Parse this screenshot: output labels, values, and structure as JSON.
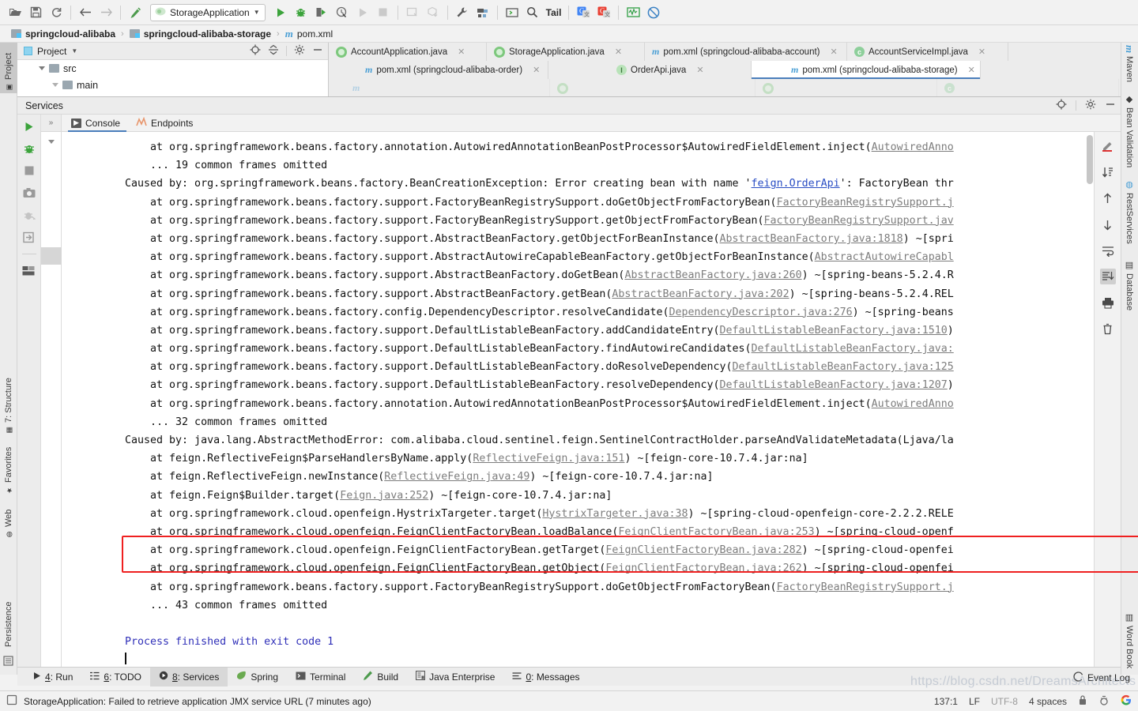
{
  "toolbar": {
    "run_config": "StorageApplication",
    "tail_label": "Tail",
    "buttons": [
      {
        "name": "open-project",
        "icon": "folder-open-icon"
      },
      {
        "name": "save-all",
        "icon": "save-icon"
      },
      {
        "name": "sync",
        "icon": "refresh-icon"
      },
      {
        "name": "back",
        "icon": "arrow-left-icon"
      },
      {
        "name": "forward",
        "icon": "arrow-right-icon"
      },
      {
        "name": "build",
        "icon": "hammer-icon"
      }
    ]
  },
  "breadcrumb": {
    "items": [
      {
        "label": "springcloud-alibaba",
        "icon": "module-folder-icon",
        "bold": true
      },
      {
        "label": "springcloud-alibaba-storage",
        "icon": "module-folder-icon",
        "bold": true
      },
      {
        "label": "pom.xml",
        "icon": "maven-icon",
        "bold": false
      }
    ],
    "separator": "›"
  },
  "left_strip": {
    "items": [
      {
        "label": "Project",
        "icon": "project-icon",
        "active": true
      },
      {
        "label": "7: Structure",
        "icon": "structure-icon",
        "active": false
      },
      {
        "label": "Favorites",
        "icon": "star-icon",
        "active": false
      },
      {
        "label": "Web",
        "icon": "web-icon",
        "active": false
      },
      {
        "label": "Persistence",
        "icon": "persistence-icon",
        "active": false
      }
    ]
  },
  "right_strip": {
    "items": [
      {
        "label": "Maven",
        "icon": "maven-icon"
      },
      {
        "label": "Bean Validation",
        "icon": "bean-validation-icon"
      },
      {
        "label": "RestServices",
        "icon": "rest-services-icon"
      },
      {
        "label": "Database",
        "icon": "database-icon"
      },
      {
        "label": "Word Book",
        "icon": "word-book-icon"
      }
    ]
  },
  "project_panel": {
    "title": "Project",
    "tree": [
      {
        "label": "src",
        "depth": 1
      },
      {
        "label": "main",
        "depth": 2
      }
    ]
  },
  "editor_tabs": {
    "row1": [
      {
        "label": "AccountApplication.java",
        "icon": "spring-class-icon",
        "selected": false
      },
      {
        "label": "StorageApplication.java",
        "icon": "spring-class-icon",
        "selected": false
      },
      {
        "label": "pom.xml (springcloud-alibaba-account)",
        "icon": "maven-icon",
        "selected": false
      },
      {
        "label": "AccountServiceImpl.java",
        "icon": "class-icon",
        "selected": false
      }
    ],
    "row2": [
      {
        "label": "pom.xml (springcloud-alibaba-order)",
        "icon": "maven-icon",
        "selected": false
      },
      {
        "label": "OrderApi.java",
        "icon": "interface-icon",
        "selected": false
      },
      {
        "label": "pom.xml (springcloud-alibaba-storage)",
        "icon": "maven-icon",
        "selected": true
      }
    ],
    "close_glyph": "✕"
  },
  "services": {
    "title": "Services",
    "tabs": [
      {
        "label": "Console",
        "icon": "console-icon",
        "active": true
      },
      {
        "label": "Endpoints",
        "icon": "endpoints-icon",
        "active": false
      }
    ],
    "gutter_icons": [
      {
        "name": "rerun-icon"
      },
      {
        "name": "debug-icon"
      },
      {
        "name": "stop-icon"
      },
      {
        "name": "camera-icon"
      },
      {
        "name": "suspend-icon"
      },
      {
        "name": "export-icon"
      },
      {
        "name": "layout-icon"
      }
    ],
    "right_toolbar_icons": [
      {
        "name": "soft-wrap-icon"
      },
      {
        "name": "scroll-to-end-icon"
      },
      {
        "name": "up-arrow-icon"
      },
      {
        "name": "down-arrow-icon"
      },
      {
        "name": "wrap-text-icon"
      },
      {
        "name": "scroll-to-bottom-icon",
        "active": true
      },
      {
        "name": "print-icon"
      },
      {
        "name": "trash-icon"
      }
    ]
  },
  "console_lines": [
    {
      "id": "l1",
      "text": "    at org.springframework.beans.factory.annotation.AutowiredAnnotationBeanPostProcessor$AutowiredFieldElement.inject(",
      "link": "AutowiredAnno",
      "tail": ""
    },
    {
      "id": "l2",
      "text": "    ... 19 common frames omitted",
      "link": "",
      "tail": ""
    },
    {
      "id": "l3",
      "text": "Caused by: org.springframework.beans.factory.BeanCreationException: Error creating bean with name '",
      "link": "feign.OrderApi",
      "tail": "': FactoryBean thr",
      "link_style": "blue"
    },
    {
      "id": "l4",
      "text": "    at org.springframework.beans.factory.support.FactoryBeanRegistrySupport.doGetObjectFromFactoryBean(",
      "link": "FactoryBeanRegistrySupport.j",
      "tail": ""
    },
    {
      "id": "l5",
      "text": "    at org.springframework.beans.factory.support.FactoryBeanRegistrySupport.getObjectFromFactoryBean(",
      "link": "FactoryBeanRegistrySupport.jav",
      "tail": ""
    },
    {
      "id": "l6",
      "text": "    at org.springframework.beans.factory.support.AbstractBeanFactory.getObjectForBeanInstance(",
      "link": "AbstractBeanFactory.java:1818",
      "tail": ") ~[spri"
    },
    {
      "id": "l7",
      "text": "    at org.springframework.beans.factory.support.AbstractAutowireCapableBeanFactory.getObjectForBeanInstance(",
      "link": "AbstractAutowireCapabl",
      "tail": ""
    },
    {
      "id": "l8",
      "text": "    at org.springframework.beans.factory.support.AbstractBeanFactory.doGetBean(",
      "link": "AbstractBeanFactory.java:260",
      "tail": ") ~[spring-beans-5.2.4.R"
    },
    {
      "id": "l9",
      "text": "    at org.springframework.beans.factory.support.AbstractBeanFactory.getBean(",
      "link": "AbstractBeanFactory.java:202",
      "tail": ") ~[spring-beans-5.2.4.REL"
    },
    {
      "id": "l10",
      "text": "    at org.springframework.beans.factory.config.DependencyDescriptor.resolveCandidate(",
      "link": "DependencyDescriptor.java:276",
      "tail": ") ~[spring-beans"
    },
    {
      "id": "l11",
      "text": "    at org.springframework.beans.factory.support.DefaultListableBeanFactory.addCandidateEntry(",
      "link": "DefaultListableBeanFactory.java:1510",
      "tail": ")"
    },
    {
      "id": "l12",
      "text": "    at org.springframework.beans.factory.support.DefaultListableBeanFactory.findAutowireCandidates(",
      "link": "DefaultListableBeanFactory.java:",
      "tail": ""
    },
    {
      "id": "l13",
      "text": "    at org.springframework.beans.factory.support.DefaultListableBeanFactory.doResolveDependency(",
      "link": "DefaultListableBeanFactory.java:125",
      "tail": ""
    },
    {
      "id": "l14",
      "text": "    at org.springframework.beans.factory.support.DefaultListableBeanFactory.resolveDependency(",
      "link": "DefaultListableBeanFactory.java:1207",
      "tail": ")"
    },
    {
      "id": "l15",
      "text": "    at org.springframework.beans.factory.annotation.AutowiredAnnotationBeanPostProcessor$AutowiredFieldElement.inject(",
      "link": "AutowiredAnno",
      "tail": ""
    },
    {
      "id": "l16",
      "text": "    ... 32 common frames omitted",
      "link": "",
      "tail": ""
    },
    {
      "id": "l17",
      "text": "Caused by: java.lang.AbstractMethodError: com.alibaba.cloud.sentinel.feign.SentinelContractHolder.parseAndValidateMetadata(Ljava/la",
      "link": "",
      "tail": ""
    },
    {
      "id": "l18",
      "text": "    at feign.ReflectiveFeign$ParseHandlersByName.apply(",
      "link": "ReflectiveFeign.java:151",
      "tail": ") ~[feign-core-10.7.4.jar:na]"
    },
    {
      "id": "l19",
      "text": "    at feign.ReflectiveFeign.newInstance(",
      "link": "ReflectiveFeign.java:49",
      "tail": ") ~[feign-core-10.7.4.jar:na]"
    },
    {
      "id": "l20",
      "text": "    at feign.Feign$Builder.target(",
      "link": "Feign.java:252",
      "tail": ") ~[feign-core-10.7.4.jar:na]"
    },
    {
      "id": "l21",
      "text": "    at org.springframework.cloud.openfeign.HystrixTargeter.target(",
      "link": "HystrixTargeter.java:38",
      "tail": ") ~[spring-cloud-openfeign-core-2.2.2.RELE"
    },
    {
      "id": "l22",
      "text": "    at org.springframework.cloud.openfeign.FeignClientFactoryBean.loadBalance(",
      "link": "FeignClientFactoryBean.java:253",
      "tail": ") ~[spring-cloud-openf"
    },
    {
      "id": "l23",
      "text": "    at org.springframework.cloud.openfeign.FeignClientFactoryBean.getTarget(",
      "link": "FeignClientFactoryBean.java:282",
      "tail": ") ~[spring-cloud-openfei"
    },
    {
      "id": "l24",
      "text": "    at org.springframework.cloud.openfeign.FeignClientFactoryBean.getObject(",
      "link": "FeignClientFactoryBean.java:262",
      "tail": ") ~[spring-cloud-openfei"
    },
    {
      "id": "l25",
      "text": "    at org.springframework.beans.factory.support.FactoryBeanRegistrySupport.doGetObjectFromFactoryBean(",
      "link": "FactoryBeanRegistrySupport.j",
      "tail": ""
    },
    {
      "id": "l26",
      "text": "    ... 43 common frames omitted",
      "link": "",
      "tail": ""
    },
    {
      "id": "l27",
      "text": "",
      "link": "",
      "tail": ""
    },
    {
      "id": "l28",
      "text": "Process finished with exit code 1",
      "link": "",
      "tail": "",
      "style": "exit"
    }
  ],
  "bottom_tabs": [
    {
      "num": "4",
      "label": "Run",
      "icon": "run-icon",
      "active": false
    },
    {
      "num": "6",
      "label": "TODO",
      "icon": "todo-icon",
      "active": false
    },
    {
      "num": "8",
      "label": "Services",
      "icon": "services-icon",
      "active": true
    },
    {
      "num": "",
      "label": "Spring",
      "icon": "spring-icon",
      "active": false
    },
    {
      "num": "",
      "label": "Terminal",
      "icon": "terminal-icon",
      "active": false
    },
    {
      "num": "",
      "label": "Build",
      "icon": "build-icon",
      "active": false
    },
    {
      "num": "",
      "label": "Java Enterprise",
      "icon": "java-enterprise-icon",
      "active": false
    },
    {
      "num": "0",
      "label": "Messages",
      "icon": "messages-icon",
      "active": false
    }
  ],
  "event_log": {
    "label": "Event Log"
  },
  "statusbar": {
    "message": "StorageApplication: Failed to retrieve application JMX service URL (7 minutes ago)",
    "caret_position": "137:1",
    "line_separator": "LF",
    "encoding": "UTF-8",
    "indent": "4 spaces"
  },
  "watermark": "https://blog.csdn.net/DreamsArchitects",
  "colors": {
    "accent_blue": "#4a7ebb",
    "error_red": "#ef2020",
    "link_grey": "#7d7d7d",
    "link_blue": "#2a4ec4",
    "exit_text": "#2f2fb8",
    "panel_bg": "#ececec",
    "console_bg": "#ffffff"
  }
}
